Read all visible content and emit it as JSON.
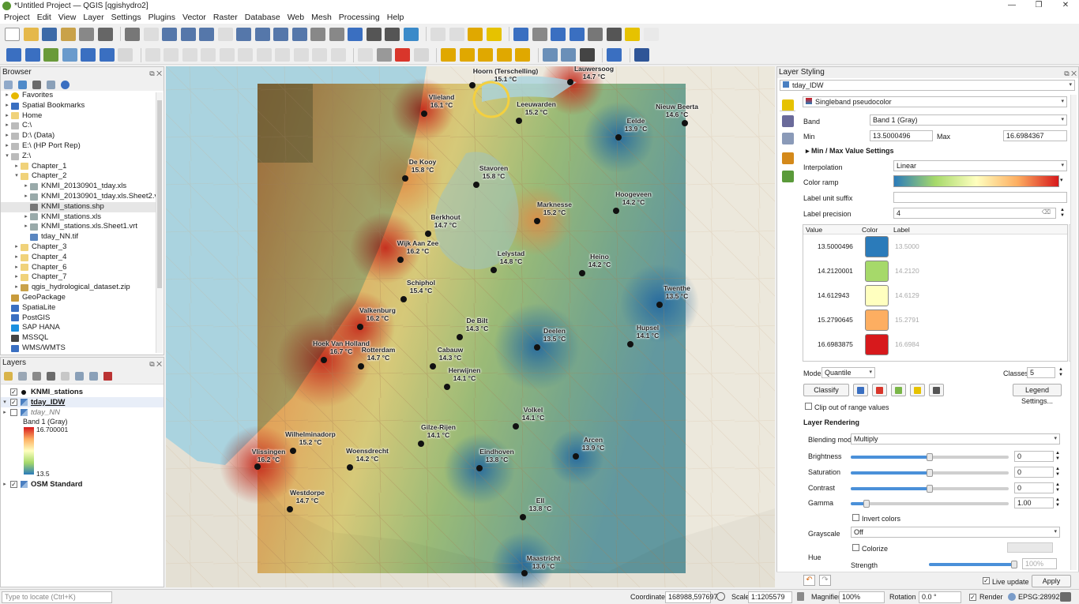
{
  "window": {
    "title": "*Untitled Project — QGIS [qgishydro2]",
    "controls": [
      "—",
      "❐",
      "✕"
    ]
  },
  "menu": [
    "Project",
    "Edit",
    "View",
    "Layer",
    "Settings",
    "Plugins",
    "Vector",
    "Raster",
    "Database",
    "Web",
    "Mesh",
    "Processing",
    "Help"
  ],
  "browser": {
    "title": "Browser",
    "items": [
      {
        "label": "Favorites",
        "depth": 0,
        "arrow": "▸",
        "icon": "star-icon"
      },
      {
        "label": "Spatial Bookmarks",
        "depth": 0,
        "arrow": "▸",
        "icon": "bookmark-icon"
      },
      {
        "label": "Home",
        "depth": 0,
        "arrow": "▸",
        "icon": "folder-icon"
      },
      {
        "label": "C:\\",
        "depth": 0,
        "arrow": "▸",
        "icon": "drive-icon"
      },
      {
        "label": "D:\\ (Data)",
        "depth": 0,
        "arrow": "▸",
        "icon": "drive-icon"
      },
      {
        "label": "E:\\ (HP Port Rep)",
        "depth": 0,
        "arrow": "▸",
        "icon": "drive-icon"
      },
      {
        "label": "Z:\\",
        "depth": 0,
        "arrow": "▾",
        "icon": "drive-icon"
      },
      {
        "label": "Chapter_1",
        "depth": 1,
        "arrow": "▸",
        "icon": "folder-icon"
      },
      {
        "label": "Chapter_2",
        "depth": 1,
        "arrow": "▾",
        "icon": "folder-icon"
      },
      {
        "label": "KNMI_20130901_tday.xls",
        "depth": 2,
        "arrow": "▸",
        "icon": "table-icon"
      },
      {
        "label": "KNMI_20130901_tday.xls.Sheet2.vrt",
        "depth": 2,
        "arrow": "▸",
        "icon": "table-icon"
      },
      {
        "label": "KNMI_stations.shp",
        "depth": 2,
        "arrow": "",
        "icon": "points-icon",
        "selected": true
      },
      {
        "label": "KNMI_stations.xls",
        "depth": 2,
        "arrow": "▸",
        "icon": "table-icon"
      },
      {
        "label": "KNMI_stations.xls.Sheet1.vrt",
        "depth": 2,
        "arrow": "▸",
        "icon": "table-icon"
      },
      {
        "label": "tday_NN.tif",
        "depth": 2,
        "arrow": "",
        "icon": "raster-icon"
      },
      {
        "label": "Chapter_3",
        "depth": 1,
        "arrow": "▸",
        "icon": "folder-icon"
      },
      {
        "label": "Chapter_4",
        "depth": 1,
        "arrow": "▸",
        "icon": "folder-icon"
      },
      {
        "label": "Chapter_6",
        "depth": 1,
        "arrow": "▸",
        "icon": "folder-icon"
      },
      {
        "label": "Chapter_7",
        "depth": 1,
        "arrow": "▸",
        "icon": "folder-icon"
      },
      {
        "label": "qgis_hydrological_dataset.zip",
        "depth": 1,
        "arrow": "▸",
        "icon": "zip-icon"
      },
      {
        "label": "GeoPackage",
        "depth": 0,
        "arrow": "",
        "icon": "geopackage-icon"
      },
      {
        "label": "SpatiaLite",
        "depth": 0,
        "arrow": "",
        "icon": "spatialite-icon"
      },
      {
        "label": "PostGIS",
        "depth": 0,
        "arrow": "",
        "icon": "postgis-icon"
      },
      {
        "label": "SAP HANA",
        "depth": 0,
        "arrow": "",
        "icon": "hana-icon"
      },
      {
        "label": "MSSQL",
        "depth": 0,
        "arrow": "",
        "icon": "mssql-icon"
      },
      {
        "label": "WMS/WMTS",
        "depth": 0,
        "arrow": "",
        "icon": "wms-icon"
      }
    ]
  },
  "layers": {
    "title": "Layers",
    "items": [
      {
        "label": "KNMI_stations",
        "checked": true,
        "bold": true
      },
      {
        "label": "tday_IDW",
        "checked": true,
        "bold": true,
        "underline": true
      },
      {
        "label": "tday_NN",
        "checked": false,
        "italic": true
      }
    ],
    "legend": {
      "band": "Band 1 (Gray)",
      "max": "16.700001",
      "min": "13.5"
    },
    "basemap": "OSM Standard"
  },
  "stations": [
    {
      "name": "Hoorn (Terschelling)",
      "temp": "15.1 °C"
    },
    {
      "name": "Lauwersoog",
      "temp": "14.7 °C"
    },
    {
      "name": "Vlieland",
      "temp": "16.1 °C"
    },
    {
      "name": "Leeuwarden",
      "temp": "15.2 °C"
    },
    {
      "name": "Nieuw Beerta",
      "temp": "14.6 °C"
    },
    {
      "name": "Eelde",
      "temp": "13.9 °C"
    },
    {
      "name": "De Kooy",
      "temp": "15.8 °C"
    },
    {
      "name": "Stavoren",
      "temp": "15.8 °C"
    },
    {
      "name": "Hoogeveen",
      "temp": "14.2 °C"
    },
    {
      "name": "Berkhout",
      "temp": "14.7 °C"
    },
    {
      "name": "Marknesse",
      "temp": "15.2 °C"
    },
    {
      "name": "Wijk Aan Zee",
      "temp": "16.2 °C"
    },
    {
      "name": "Lelystad",
      "temp": "14.8 °C"
    },
    {
      "name": "Heino",
      "temp": "14.2 °C"
    },
    {
      "name": "Schiphol",
      "temp": "15.4 °C"
    },
    {
      "name": "Twenthe",
      "temp": "13.5 °C"
    },
    {
      "name": "Valkenburg",
      "temp": "16.2 °C"
    },
    {
      "name": "De Bilt",
      "temp": "14.3 °C"
    },
    {
      "name": "Hupsel",
      "temp": "14.1 °C"
    },
    {
      "name": "Deelen",
      "temp": "13.5 °C"
    },
    {
      "name": "Hoek Van Holland",
      "temp": "16.7 °C"
    },
    {
      "name": "Cabauw",
      "temp": "14.3 °C"
    },
    {
      "name": "Rotterdam",
      "temp": "14.7 °C"
    },
    {
      "name": "Herwijnen",
      "temp": "14.1 °C"
    },
    {
      "name": "Volkel",
      "temp": "14.1 °C"
    },
    {
      "name": "Wilhelminadorp",
      "temp": "15.2 °C"
    },
    {
      "name": "Gilze-Rijen",
      "temp": "14.1 °C"
    },
    {
      "name": "Arcen",
      "temp": "13.9 °C"
    },
    {
      "name": "Vlissingen",
      "temp": "16.2 °C"
    },
    {
      "name": "Woensdrecht",
      "temp": "14.2 °C"
    },
    {
      "name": "Eindhoven",
      "temp": "13.8 °C"
    },
    {
      "name": "Westdorpe",
      "temp": "14.7 °C"
    },
    {
      "name": "Ell",
      "temp": "13.8 °C"
    },
    {
      "name": "Maastricht",
      "temp": "13.6 °C"
    }
  ],
  "styling": {
    "title": "Layer Styling",
    "layer": "tday_IDW",
    "renderer": "Singleband pseudocolor",
    "band_label": "Band",
    "band": "Band 1 (Gray)",
    "min_label": "Min",
    "min": "13.5000496",
    "max_label": "Max",
    "max": "16.6984367",
    "minmax_settings": "Min / Max Value Settings",
    "interp_label": "Interpolation",
    "interp": "Linear",
    "ramp_label": "Color ramp",
    "suffix_label": "Label unit suffix",
    "suffix": "",
    "precision_label": "Label precision",
    "precision": "4",
    "table_headers": [
      "Value",
      "Color",
      "Label"
    ],
    "classes": [
      {
        "value": "13.5000496",
        "color": "#2b7bba",
        "label": "13.5000"
      },
      {
        "value": "14.2120001",
        "color": "#a6d96a",
        "label": "14.2120"
      },
      {
        "value": "14.612943",
        "color": "#ffffbf",
        "label": "14.6129"
      },
      {
        "value": "15.2790645",
        "color": "#fdae61",
        "label": "15.2791"
      },
      {
        "value": "16.6983875",
        "color": "#d7191c",
        "label": "16.6984"
      }
    ],
    "mode_label": "Mode",
    "mode": "Quantile",
    "classes_label": "Classes",
    "classes_count": "5",
    "classify": "Classify",
    "legend_settings": "Legend Settings...",
    "clip_label": "Clip out of range values",
    "rendering_title": "Layer Rendering",
    "blend_label": "Blending mode",
    "blend": "Multiply",
    "brightness_label": "Brightness",
    "brightness": "0",
    "brightness_level": 0.5,
    "saturation_label": "Saturation",
    "saturation": "0",
    "saturation_level": 0.5,
    "contrast_label": "Contrast",
    "contrast": "0",
    "contrast_level": 0.5,
    "gamma_label": "Gamma",
    "gamma": "1.00",
    "gamma_level": 0.1,
    "invert_label": "Invert colors",
    "grayscale_label": "Grayscale",
    "grayscale": "Off",
    "colorize_label": "Colorize",
    "hue_label": "Hue",
    "strength_label": "Strength",
    "strength": "100%",
    "strength_level": 1.0,
    "live_update": "Live update",
    "apply": "Apply"
  },
  "statusbar": {
    "locate_placeholder": "Type to locate (Ctrl+K)",
    "coord_label": "Coordinate",
    "coord": "168988,597697",
    "scale_label": "Scale",
    "scale": "1:1205579",
    "magnifier_label": "Magnifier",
    "magnifier": "100%",
    "rotation_label": "Rotation",
    "rotation": "0.0 °",
    "render_label": "Render",
    "crs": "EPSG:28992"
  }
}
